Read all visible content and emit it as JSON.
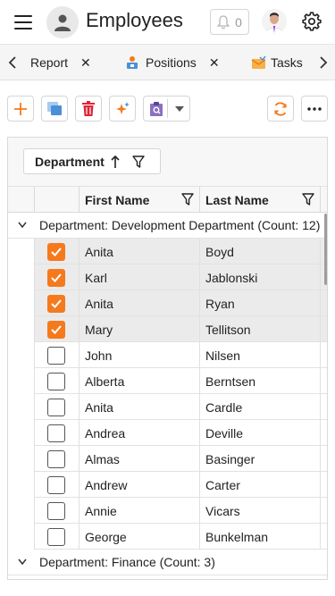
{
  "header": {
    "title": "Employees",
    "notification_count": "0"
  },
  "tabs": [
    {
      "label": "Report",
      "icon": "report-icon"
    },
    {
      "label": "Positions",
      "icon": "positions-icon"
    },
    {
      "label": "Tasks",
      "icon": "tasks-icon"
    }
  ],
  "toolbar": {
    "buttons": [
      "add-icon",
      "copy-icon",
      "delete-icon",
      "magic-wand-icon",
      "clipboard-icon",
      "dropdown-arrow-icon",
      "refresh-icon",
      "more-icon"
    ]
  },
  "colors": {
    "accent": "#f57a1e",
    "delete_red": "#e0253a",
    "copy_blue": "#4a90d9",
    "clipboard_purple": "#8a6fc2",
    "selected_row": "#ebebeb"
  },
  "grid": {
    "group_panel": {
      "label": "Department"
    },
    "columns": {
      "first_name": "First Name",
      "last_name": "Last Name"
    },
    "groups": [
      {
        "label": "Department: Development Department (Count: 12)",
        "rows": [
          {
            "first": "Anita",
            "last": "Boyd",
            "checked": true
          },
          {
            "first": "Karl",
            "last": "Jablonski",
            "checked": true
          },
          {
            "first": "Anita",
            "last": "Ryan",
            "checked": true
          },
          {
            "first": "Mary",
            "last": "Tellitson",
            "checked": true
          },
          {
            "first": "John",
            "last": "Nilsen",
            "checked": false
          },
          {
            "first": "Alberta",
            "last": "Berntsen",
            "checked": false
          },
          {
            "first": "Anita",
            "last": "Cardle",
            "checked": false
          },
          {
            "first": "Andrea",
            "last": "Deville",
            "checked": false
          },
          {
            "first": "Almas",
            "last": "Basinger",
            "checked": false
          },
          {
            "first": "Andrew",
            "last": "Carter",
            "checked": false
          },
          {
            "first": "Annie",
            "last": "Vicars",
            "checked": false
          },
          {
            "first": "George",
            "last": "Bunkelman",
            "checked": false
          }
        ]
      },
      {
        "label": "Department: Finance (Count: 3)",
        "rows": []
      }
    ]
  }
}
